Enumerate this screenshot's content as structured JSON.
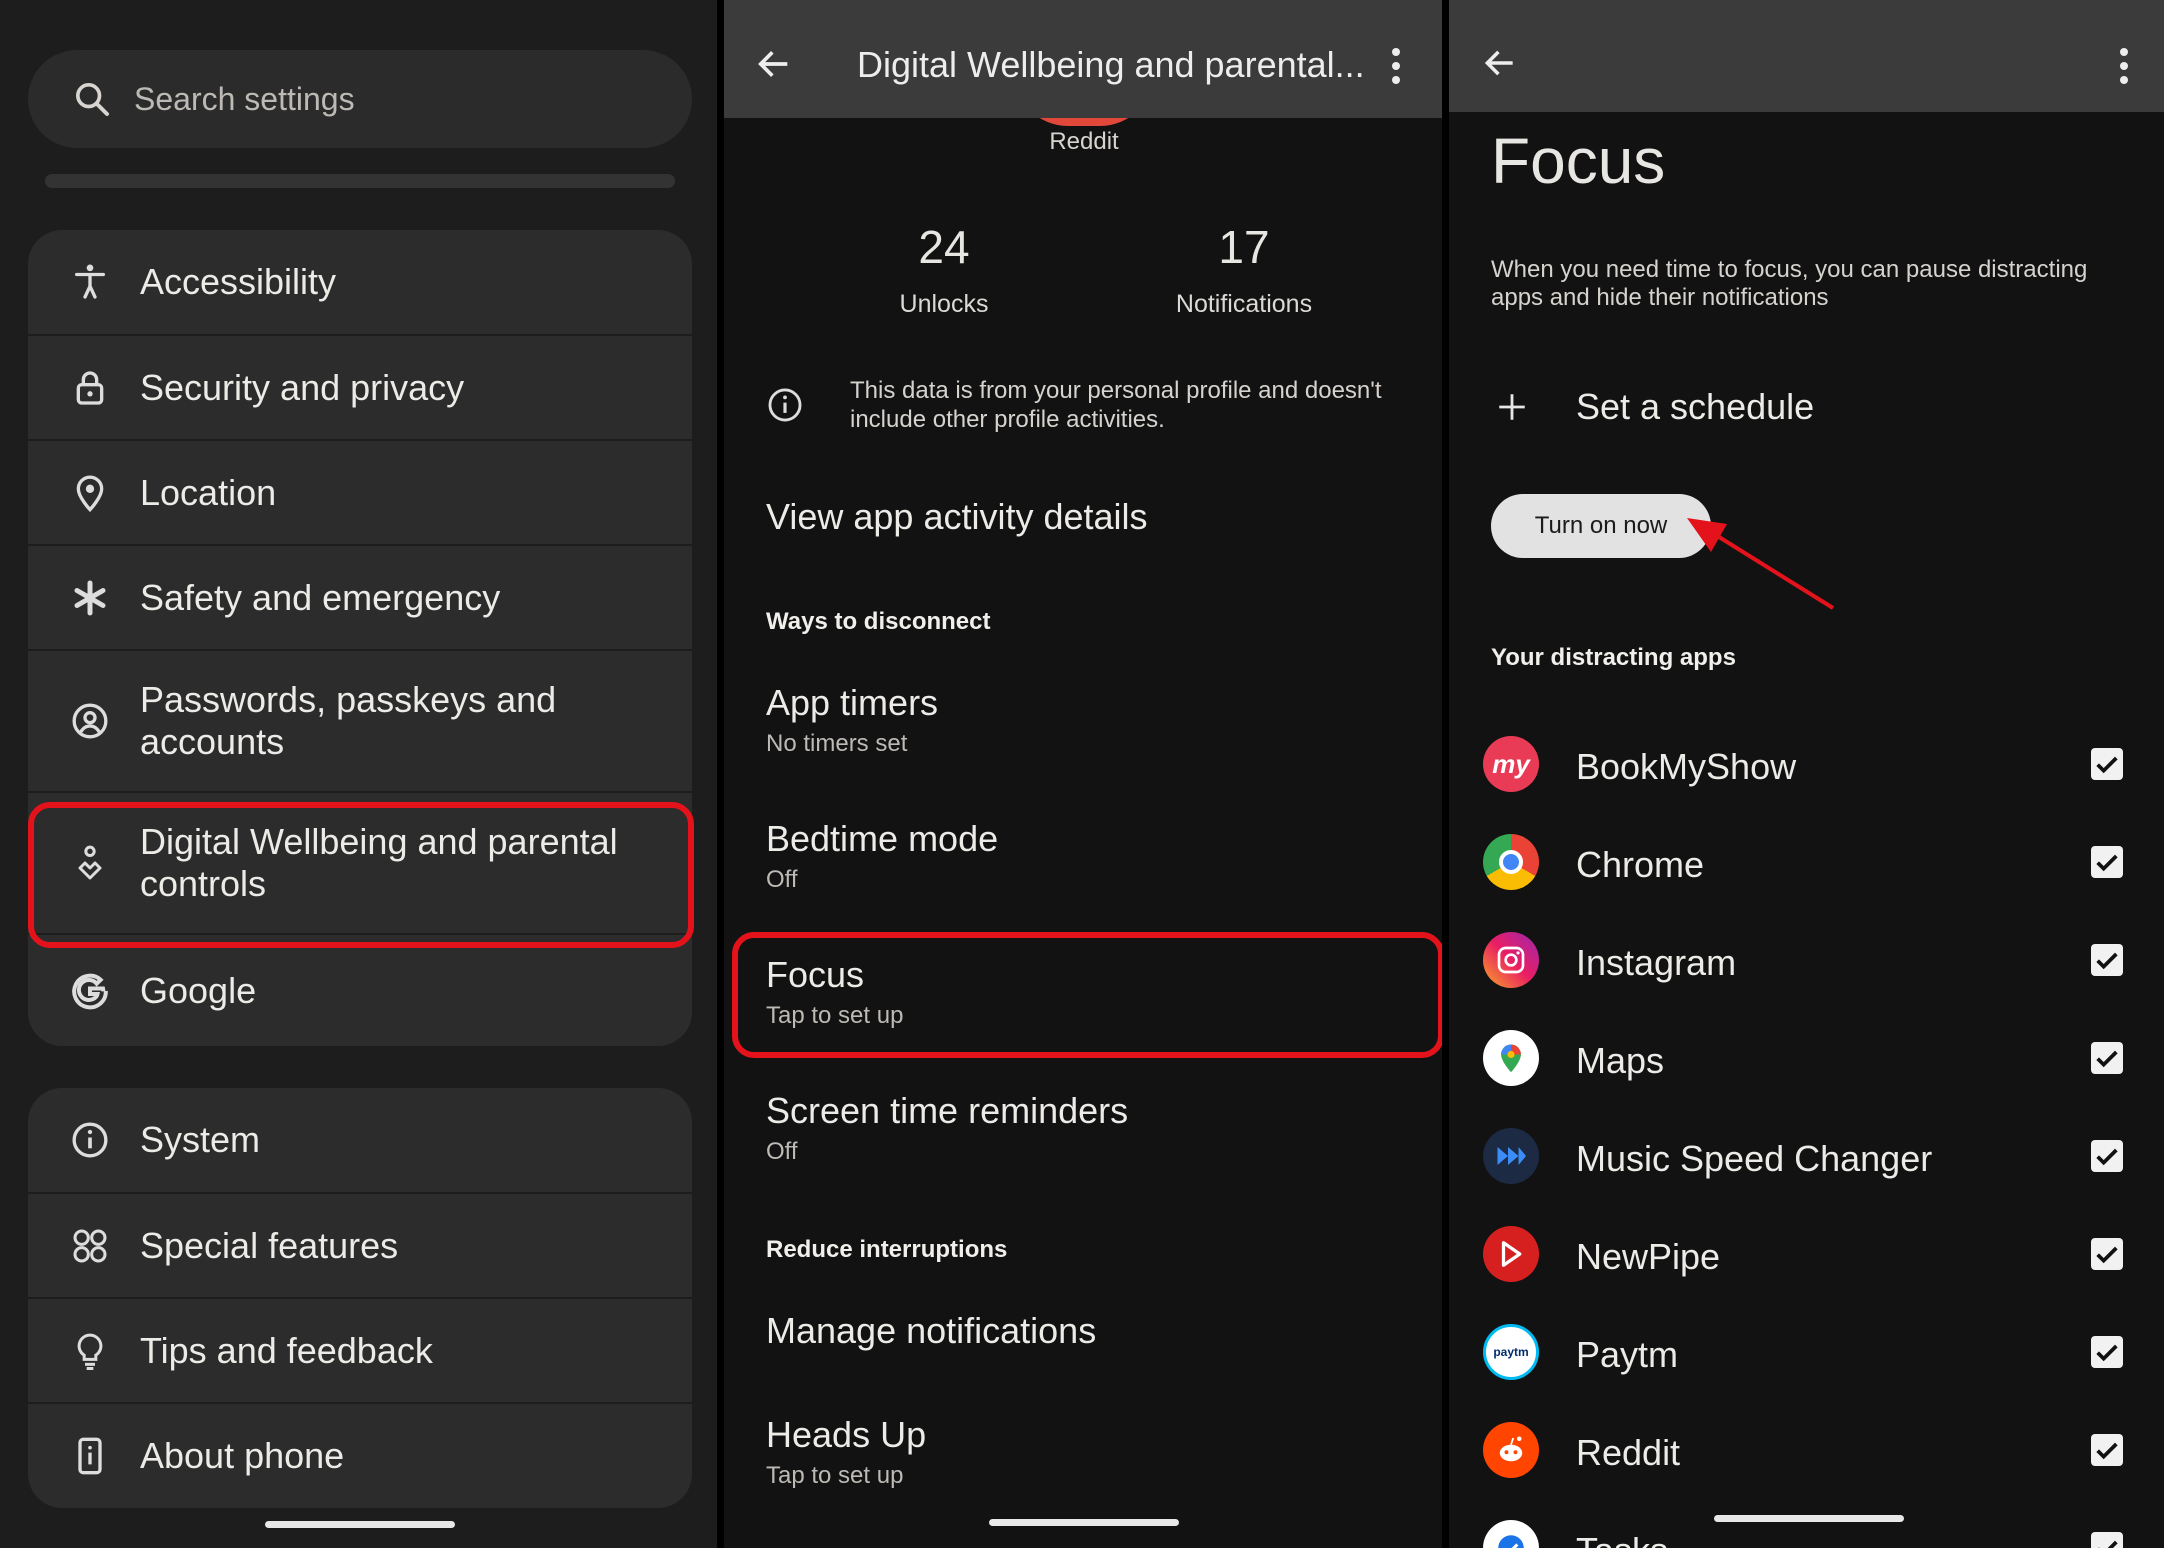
{
  "colors": {
    "highlight": "#e4131b",
    "arrow": "#e4131b",
    "background": "#121212",
    "card": "#2c2c2c"
  },
  "settings": {
    "search_placeholder": "Search settings",
    "items": [
      {
        "label": "Accessibility",
        "icon": "accessibility-icon"
      },
      {
        "label": "Security and privacy",
        "icon": "lock-icon"
      },
      {
        "label": "Location",
        "icon": "location-pin-icon"
      },
      {
        "label": "Safety and emergency",
        "icon": "asterisk-icon"
      },
      {
        "label": "Passwords, passkeys and accounts",
        "icon": "account-circle-icon"
      },
      {
        "label": "Digital Wellbeing and parental controls",
        "icon": "wellbeing-icon"
      },
      {
        "label": "Google",
        "icon": "google-g-icon"
      }
    ],
    "items2": [
      {
        "label": "System",
        "icon": "info-icon"
      },
      {
        "label": "Special features",
        "icon": "special-features-icon"
      },
      {
        "label": "Tips and feedback",
        "icon": "lightbulb-icon"
      },
      {
        "label": "About phone",
        "icon": "phone-icon"
      }
    ]
  },
  "wellbeing": {
    "title": "Digital Wellbeing and parental...",
    "top_app_label": "Reddit",
    "stats": [
      {
        "value": "24",
        "label": "Unlocks"
      },
      {
        "value": "17",
        "label": "Notifications"
      }
    ],
    "info_text": "This data is from your personal profile and doesn't include other profile activities.",
    "view_details": "View app activity details",
    "section_disconnect": "Ways to disconnect",
    "rows": [
      {
        "title": "App timers",
        "sub": "No timers set"
      },
      {
        "title": "Bedtime mode",
        "sub": "Off"
      },
      {
        "title": "Focus",
        "sub": "Tap to set up"
      },
      {
        "title": "Screen time reminders",
        "sub": "Off"
      }
    ],
    "section_interruptions": "Reduce interruptions",
    "manage_notifications": "Manage notifications",
    "heads_up": {
      "title": "Heads Up",
      "sub": "Tap to set up"
    }
  },
  "focus": {
    "title": "Focus",
    "description": "When you need time to focus, you can pause distracting apps and hide their notifications",
    "schedule_label": "Set a schedule",
    "turn_on_label": "Turn on now",
    "section_apps": "Your distracting apps",
    "apps": [
      {
        "name": "BookMyShow",
        "icon": "bookmyshow-icon",
        "checked": true
      },
      {
        "name": "Chrome",
        "icon": "chrome-icon",
        "checked": true
      },
      {
        "name": "Instagram",
        "icon": "instagram-icon",
        "checked": true
      },
      {
        "name": "Maps",
        "icon": "maps-icon",
        "checked": true
      },
      {
        "name": "Music Speed Changer",
        "icon": "music-speed-changer-icon",
        "checked": true
      },
      {
        "name": "NewPipe",
        "icon": "newpipe-icon",
        "checked": true
      },
      {
        "name": "Paytm",
        "icon": "paytm-icon",
        "checked": true
      },
      {
        "name": "Reddit",
        "icon": "reddit-icon",
        "checked": true
      },
      {
        "name": "Tasks",
        "icon": "tasks-icon",
        "checked": true
      }
    ]
  }
}
